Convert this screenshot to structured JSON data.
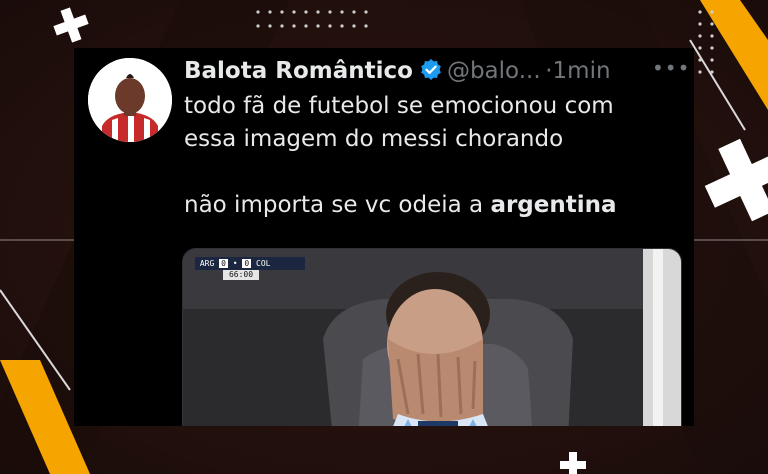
{
  "tweet": {
    "display_name": "Balota Romântico",
    "handle": "@balo...",
    "separator": "·",
    "time": "1min",
    "more_label": "•••",
    "lines": [
      "todo fã de futebol se emocionou com",
      "essa imagem do messi chorando"
    ],
    "line3_prefix": "não importa se vc odeia a ",
    "line3_bold": "argentina"
  },
  "media": {
    "home_team": "ARG",
    "home_score": "0",
    "away_score": "0",
    "away_team": "COL",
    "clock": "66:00"
  },
  "colors": {
    "accent_orange": "#f5a400",
    "verified_blue": "#1d9bf0",
    "tweet_background": "#000000",
    "text_primary": "#e7e9ea",
    "text_secondary": "#71767b"
  },
  "icons": [
    "verified-badge-icon",
    "more-options-icon",
    "plus-decoration-icon"
  ]
}
